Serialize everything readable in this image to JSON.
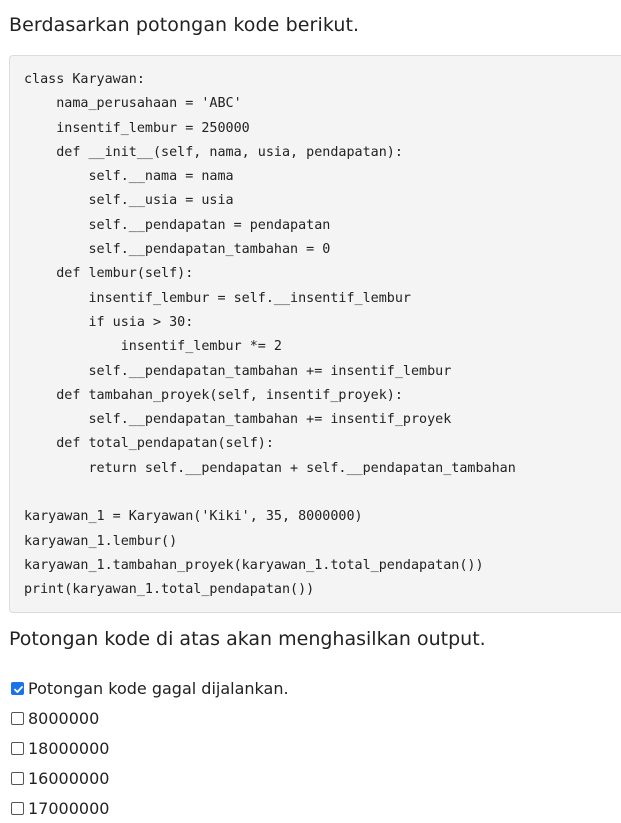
{
  "question": {
    "title": "Berdasarkan potongan kode berikut.",
    "prompt": "Potongan kode di atas akan menghasilkan output."
  },
  "code": {
    "lines": [
      "class Karyawan:",
      "    nama_perusahaan = 'ABC'",
      "    insentif_lembur = 250000",
      "    def __init__(self, nama, usia, pendapatan):",
      "        self.__nama = nama",
      "        self.__usia = usia",
      "        self.__pendapatan = pendapatan",
      "        self.__pendapatan_tambahan = 0",
      "    def lembur(self):",
      "        insentif_lembur = self.__insentif_lembur",
      "        if usia > 30:",
      "            insentif_lembur *= 2",
      "        self.__pendapatan_tambahan += insentif_lembur",
      "    def tambahan_proyek(self, insentif_proyek):",
      "        self.__pendapatan_tambahan += insentif_proyek",
      "    def total_pendapatan(self):",
      "        return self.__pendapatan + self.__pendapatan_tambahan",
      "",
      "karyawan_1 = Karyawan('Kiki', 35, 8000000)",
      "karyawan_1.lembur()",
      "karyawan_1.tambahan_proyek(karyawan_1.total_pendapatan())",
      "print(karyawan_1.total_pendapatan())"
    ]
  },
  "options": [
    {
      "label": "Potongan kode gagal dijalankan.",
      "checked": true
    },
    {
      "label": "8000000",
      "checked": false
    },
    {
      "label": "18000000",
      "checked": false
    },
    {
      "label": "16000000",
      "checked": false
    },
    {
      "label": "17000000",
      "checked": false
    }
  ],
  "colors": {
    "checkbox_checked": "#1a73e8",
    "code_background": "#f4f4f4"
  }
}
